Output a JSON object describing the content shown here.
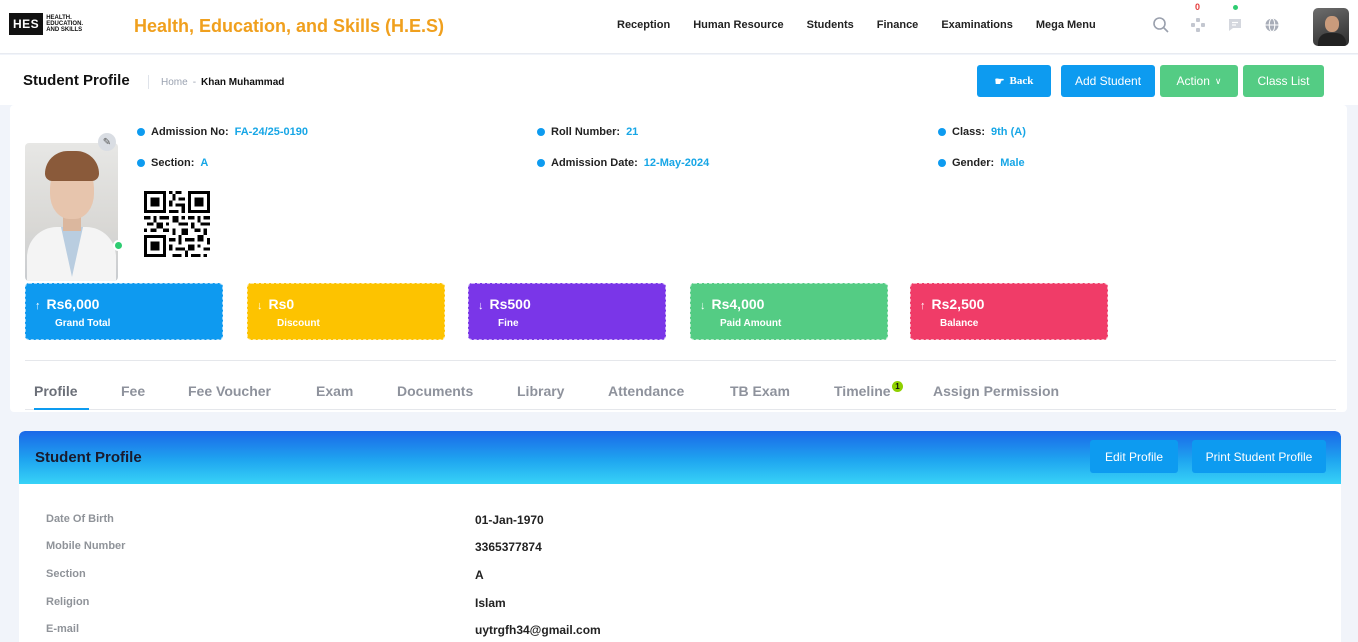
{
  "app": {
    "logo_text": "HES",
    "logo_sub": "HEALTH. EDUCATION. AND SKILLS",
    "title": "Health, Education, and Skills (H.E.S)"
  },
  "nav": {
    "items": [
      "Reception",
      "Human Resource",
      "Students",
      "Finance",
      "Examinations",
      "Mega Menu"
    ]
  },
  "top_icons": {
    "notifications_count": "0",
    "icons": [
      "search-icon",
      "apps-icon",
      "message-icon",
      "globe-icon"
    ]
  },
  "page": {
    "title": "Student Profile",
    "breadcrumb": {
      "home": "Home",
      "separator": "-",
      "current": "Khan Muhammad"
    },
    "buttons": {
      "back": "Back",
      "add_student": "Add Student",
      "action": "Action",
      "class_list": "Class List"
    }
  },
  "student": {
    "fields": [
      {
        "label": "Admission No:",
        "value": "FA-24/25-0190"
      },
      {
        "label": "Roll Number:",
        "value": "21"
      },
      {
        "label": "Class:",
        "value": "9th (A)"
      },
      {
        "label": "Section:",
        "value": "A"
      },
      {
        "label": "Admission Date:",
        "value": "12-May-2024"
      },
      {
        "label": "Gender:",
        "value": "Male"
      }
    ]
  },
  "stats": [
    {
      "arrow": "↑",
      "amount": "Rs6,000",
      "label": "Grand Total",
      "color": "#0e9af0"
    },
    {
      "arrow": "↓",
      "amount": "Rs0",
      "label": "Discount",
      "color": "#fdc300"
    },
    {
      "arrow": "↓",
      "amount": "Rs500",
      "label": "Fine",
      "color": "#7a36e8"
    },
    {
      "arrow": "↓",
      "amount": "Rs4,000",
      "label": "Paid Amount",
      "color": "#54cc84"
    },
    {
      "arrow": "↑",
      "amount": "Rs2,500",
      "label": "Balance",
      "color": "#f03c68"
    }
  ],
  "tabs": {
    "items": [
      "Profile",
      "Fee",
      "Fee Voucher",
      "Exam",
      "Documents",
      "Library",
      "Attendance",
      "TB Exam",
      "Timeline",
      "Assign Permission"
    ],
    "active": "Profile",
    "timeline_badge": "1"
  },
  "profile_panel": {
    "title": "Student Profile",
    "edit_button": "Edit Profile",
    "print_button": "Print Student Profile",
    "rows": [
      {
        "label": "Date Of Birth",
        "value": "01-Jan-1970"
      },
      {
        "label": "Mobile Number",
        "value": "3365377874"
      },
      {
        "label": "Section",
        "value": "A"
      },
      {
        "label": "Religion",
        "value": "Islam"
      },
      {
        "label": "E-mail",
        "value": "uytrgfh34@gmail.com"
      }
    ]
  }
}
